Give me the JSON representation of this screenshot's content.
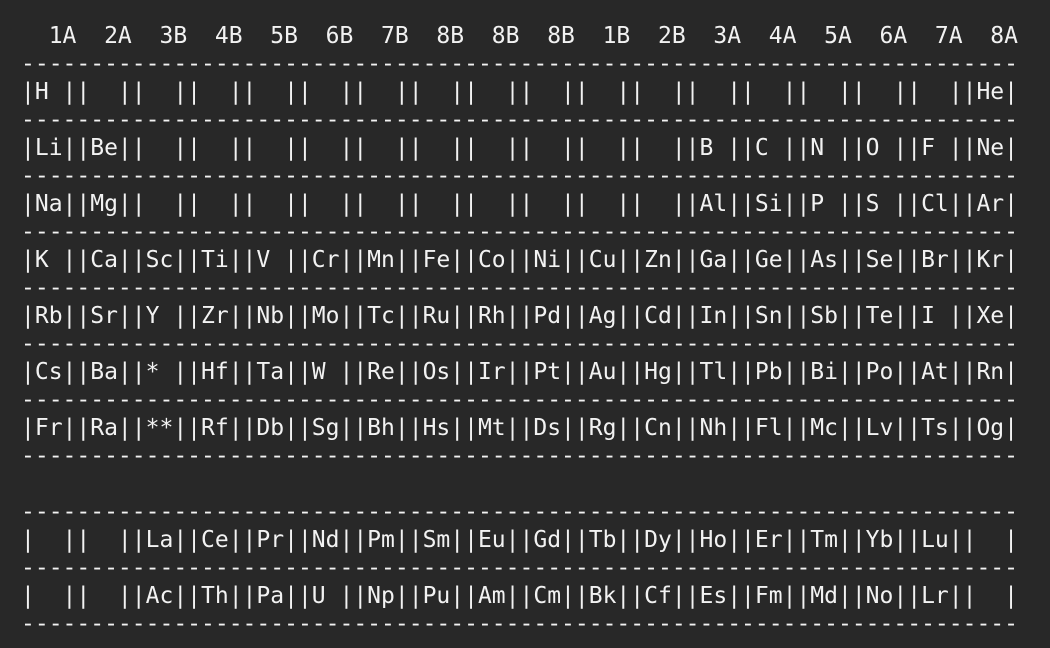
{
  "terminal": {
    "colors": {
      "background": "#282828",
      "text": "#f2f2f2"
    },
    "lines": [
      "  1A  2A  3B  4B  5B  6B  7B  8B  8B  8B  1B  2B  3A  4A  5A  6A  7A  8A",
      "------------------------------------------------------------------------",
      "|H ||  ||  ||  ||  ||  ||  ||  ||  ||  ||  ||  ||  ||  ||  ||  ||  ||He|",
      "------------------------------------------------------------------------",
      "|Li||Be||  ||  ||  ||  ||  ||  ||  ||  ||  ||  ||B ||C ||N ||O ||F ||Ne|",
      "------------------------------------------------------------------------",
      "|Na||Mg||  ||  ||  ||  ||  ||  ||  ||  ||  ||  ||Al||Si||P ||S ||Cl||Ar|",
      "------------------------------------------------------------------------",
      "|K ||Ca||Sc||Ti||V ||Cr||Mn||Fe||Co||Ni||Cu||Zn||Ga||Ge||As||Se||Br||Kr|",
      "------------------------------------------------------------------------",
      "|Rb||Sr||Y ||Zr||Nb||Mo||Tc||Ru||Rh||Pd||Ag||Cd||In||Sn||Sb||Te||I ||Xe|",
      "------------------------------------------------------------------------",
      "|Cs||Ba||* ||Hf||Ta||W ||Re||Os||Ir||Pt||Au||Hg||Tl||Pb||Bi||Po||At||Rn|",
      "------------------------------------------------------------------------",
      "|Fr||Ra||**||Rf||Db||Sg||Bh||Hs||Mt||Ds||Rg||Cn||Nh||Fl||Mc||Lv||Ts||Og|",
      "------------------------------------------------------------------------",
      "",
      "------------------------------------------------------------------------",
      "|  ||  ||La||Ce||Pr||Nd||Pm||Sm||Eu||Gd||Tb||Dy||Ho||Er||Tm||Yb||Lu||  |",
      "------------------------------------------------------------------------",
      "|  ||  ||Ac||Th||Pa||U ||Np||Pu||Am||Cm||Bk||Cf||Es||Fm||Md||No||Lr||  |",
      "------------------------------------------------------------------------"
    ]
  }
}
